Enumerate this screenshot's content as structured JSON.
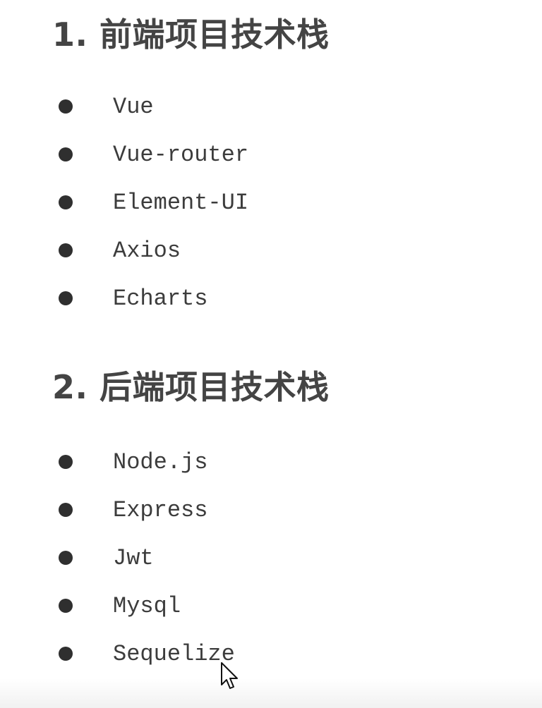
{
  "sections": [
    {
      "title": "1. 前端项目技术栈",
      "items": [
        "Vue",
        "Vue-router",
        "Element-UI",
        "Axios",
        "Echarts"
      ]
    },
    {
      "title": "2. 后端项目技术栈",
      "items": [
        "Node.js",
        "Express",
        "Jwt",
        "Mysql",
        "Sequelize"
      ]
    }
  ],
  "icons": {
    "bullet": "filled-circle-bullet",
    "cursor": "mouse-pointer-arrow"
  },
  "colors": {
    "heading": "#444444",
    "text": "#3c3c3c",
    "bullet": "#2f2f2f",
    "background": "#ffffff"
  }
}
